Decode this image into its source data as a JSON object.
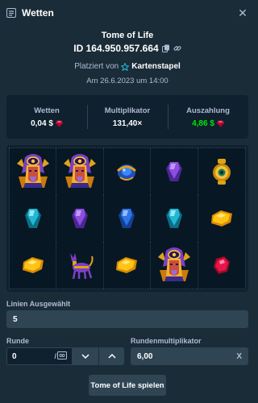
{
  "modal": {
    "title": "Wetten",
    "close_icon": "close-icon",
    "header_icon": "bet-slip-icon"
  },
  "bet": {
    "game_name": "Tome of Life",
    "id": "ID 164.950.957.664",
    "placed_by_label": "Platziert von",
    "placed_by_source": "Kartenstapel",
    "date": "Am 26.6.2023 um 14:00"
  },
  "stats": {
    "wager_label": "Wetten",
    "wager_value": "0,04 $",
    "multiplier_label": "Multiplikator",
    "multiplier_value": "131,40×",
    "payout_label": "Auszahlung",
    "payout_value": "4,86 $",
    "currency_icon": "ruby-gem-icon",
    "payout_color": "#00e701"
  },
  "reels": {
    "rows": [
      [
        "pharaoh-wild",
        "pharaoh-wild",
        "blue-scarab",
        "purple-gem",
        "golden-eye"
      ],
      [
        "teal-gem",
        "purple-gem",
        "blue-gem",
        "teal-gem",
        "yellow-gem"
      ],
      [
        "yellow-gem",
        "jackal-statue",
        "yellow-gem",
        "pharaoh-wild",
        "red-gem"
      ]
    ]
  },
  "form": {
    "lines_label": "Linien Ausgewählt",
    "lines_value": "5",
    "round_label": "Runde",
    "round_value": "0",
    "round_separator": "/",
    "round_total_icon": "infinity-icon",
    "round_multiplier_label": "Rundenmultiplikator",
    "round_multiplier_value": "6,00",
    "clear_label": "X"
  },
  "actions": {
    "play_label": "Tome of Life spielen"
  },
  "colors": {
    "background": "#1a2c38",
    "panel": "#0f212e",
    "input": "#2f4553",
    "muted_text": "#b1bad3",
    "win": "#00e701"
  }
}
